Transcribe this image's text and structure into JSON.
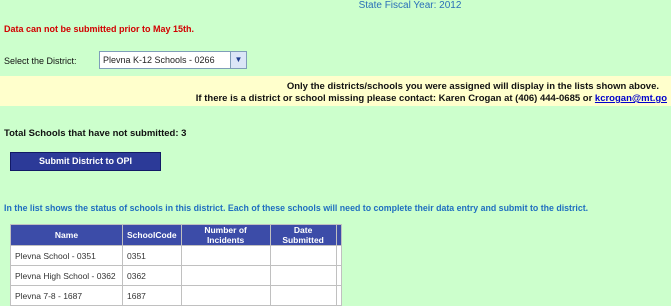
{
  "header": {
    "fiscal_year": "State Fiscal Year: 2012"
  },
  "warning": "Data can not be submitted prior to May 15th.",
  "district": {
    "label": "Select the District:",
    "selected": "Plevna K-12 Schools - 0266",
    "dropdown_icon": "chevron-down-icon"
  },
  "notice": {
    "line1": "Only the districts/schools you were assigned will display in the lists shown above.",
    "line2_prefix": "If there is a district or school missing please contact: Karen Crogan at (406) 444-0685 or ",
    "email": "kcrogan@mt.go"
  },
  "total": "Total Schools that have not submitted: 3",
  "submit_button": "Submit District to OPI",
  "info": "In the list shows the status of schools in this district. Each of these schools will need to complete their data entry and submit to the district.",
  "table": {
    "headers": [
      "Name",
      "SchoolCode",
      "Number of Incidents",
      "Date Submitted"
    ],
    "rows": [
      {
        "name": "Plevna School - 0351",
        "code": "0351",
        "incidents": "",
        "date": ""
      },
      {
        "name": "Plevna High School - 0362",
        "code": "0362",
        "incidents": "",
        "date": ""
      },
      {
        "name": "Plevna 7-8 - 1687",
        "code": "1687",
        "incidents": "",
        "date": ""
      }
    ]
  },
  "colors": {
    "background": "#ccffcc",
    "notice_bg": "#ffffcc",
    "warning": "#d20000",
    "button": "#2c3a98",
    "info_text": "#1f6fc0",
    "table_header": "#3c4ca8"
  }
}
